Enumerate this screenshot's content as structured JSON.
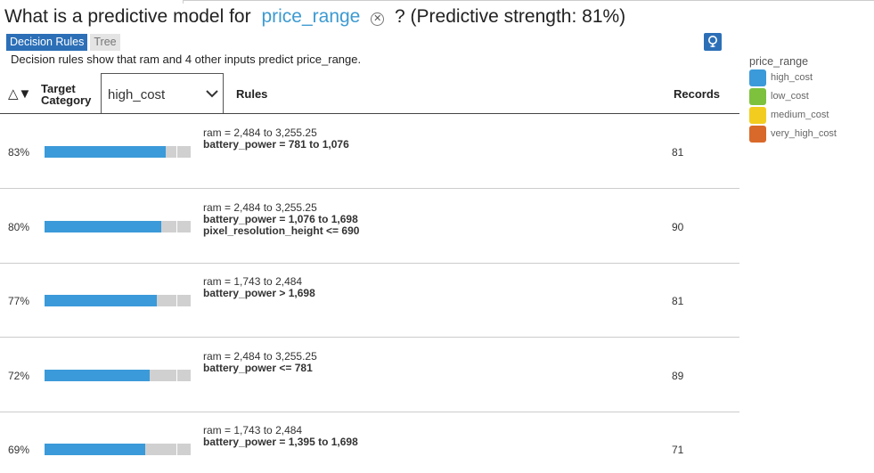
{
  "question": {
    "prefix": "What is a predictive model for",
    "target": "price_range",
    "suffix": "? (Predictive strength: 81%)"
  },
  "tabs": [
    {
      "label": "Decision Rules",
      "active": true
    },
    {
      "label": "Tree",
      "active": false
    }
  ],
  "subtitle": "Decision rules show that ram and 4 other inputs predict price_range.",
  "header": {
    "sort_icon": "sort-triangle-icon",
    "target_category_line1": "Target",
    "target_category_line2": "Category",
    "selected_category": "high_cost",
    "rules": "Rules",
    "records": "Records"
  },
  "rows": [
    {
      "pct": "83%",
      "value": 0.83,
      "rules": [
        {
          "field": "ram",
          "cond": "= 2,484 to 3,255.25"
        },
        {
          "field": "battery_power",
          "cond": "= 781 to 1,076"
        }
      ],
      "records": "81"
    },
    {
      "pct": "80%",
      "value": 0.8,
      "rules": [
        {
          "field": "ram",
          "cond": "= 2,484 to 3,255.25"
        },
        {
          "field": "battery_power",
          "cond": "= 1,076 to 1,698"
        },
        {
          "field": "pixel_resolution_height",
          "cond": "<= 690"
        }
      ],
      "records": "90"
    },
    {
      "pct": "77%",
      "value": 0.77,
      "rules": [
        {
          "field": "ram",
          "cond": "= 1,743 to 2,484"
        },
        {
          "field": "battery_power",
          "cond": "> 1,698"
        }
      ],
      "records": "81"
    },
    {
      "pct": "72%",
      "value": 0.72,
      "rules": [
        {
          "field": "ram",
          "cond": "= 2,484 to 3,255.25"
        },
        {
          "field": "battery_power",
          "cond": "<= 781"
        }
      ],
      "records": "89"
    },
    {
      "pct": "69%",
      "value": 0.69,
      "rules": [
        {
          "field": "ram",
          "cond": "= 1,743 to 2,484"
        },
        {
          "field": "battery_power",
          "cond": "= 1,395 to 1,698"
        }
      ],
      "records": "71"
    }
  ],
  "legend": {
    "title": "price_range",
    "items": [
      {
        "label": "high_cost",
        "color": "#3b9ad9"
      },
      {
        "label": "low_cost",
        "color": "#7dc13d"
      },
      {
        "label": "medium_cost",
        "color": "#f2cd1f"
      },
      {
        "label": "very_high_cost",
        "color": "#d9692a"
      }
    ]
  },
  "colors": {
    "accent": "#2c6fb7",
    "bar_fill": "#3b9ad9",
    "bar_track": "#d0d0d0"
  }
}
